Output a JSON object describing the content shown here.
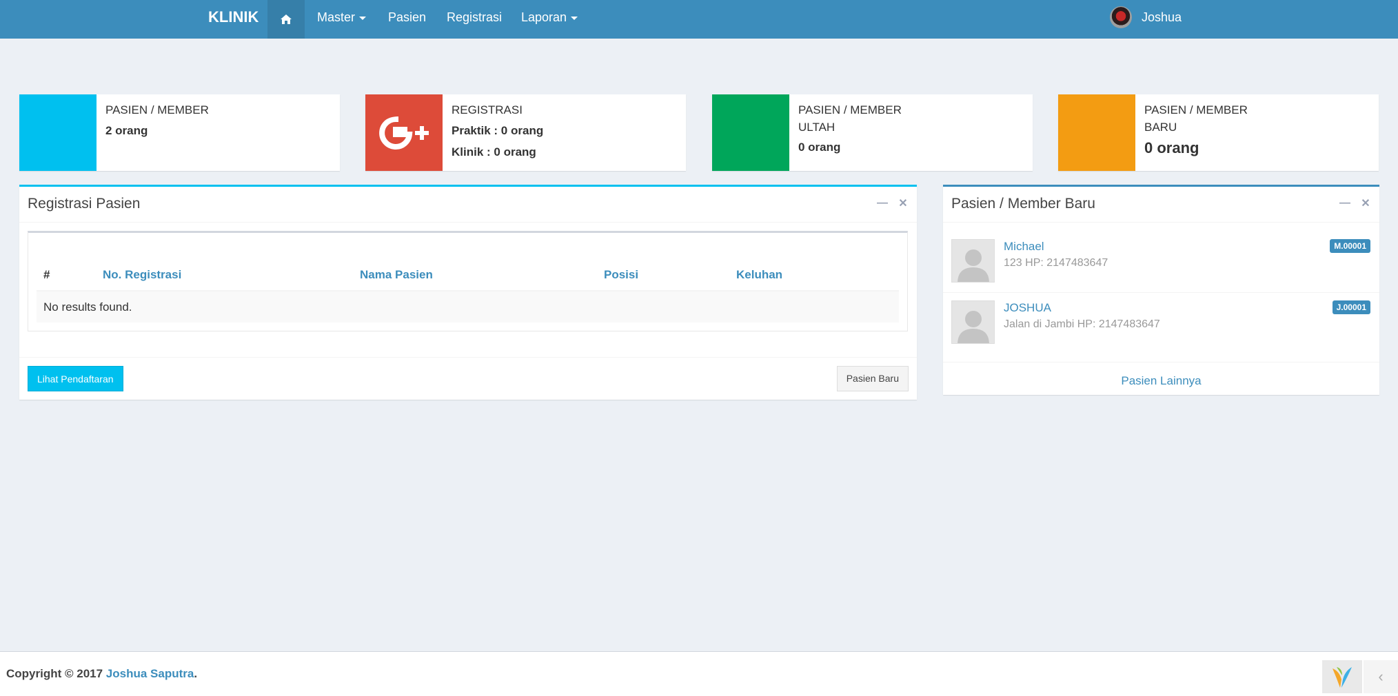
{
  "navbar": {
    "brand": "KLINIK",
    "home_icon": "home-icon",
    "items": [
      {
        "label": "Master",
        "dropdown": true
      },
      {
        "label": "Pasien",
        "dropdown": false
      },
      {
        "label": "Registrasi",
        "dropdown": false
      },
      {
        "label": "Laporan",
        "dropdown": true
      }
    ],
    "user": {
      "name": "Joshua"
    }
  },
  "info_boxes": [
    {
      "label": "PASIEN / MEMBER",
      "line1": "2 orang",
      "color": "#00c0ef",
      "icon": "user-icon"
    },
    {
      "label": "REGISTRASI",
      "line1": "Praktik : 0 orang",
      "line2": "Klinik : 0 orang",
      "color": "#dd4b39",
      "icon": "google-plus-icon"
    },
    {
      "label": "PASIEN / MEMBER",
      "label2": "ULTAH",
      "line1": "0 orang",
      "color": "#00a65a",
      "icon": "birthday-icon"
    },
    {
      "label": "PASIEN / MEMBER",
      "label2": "BARU",
      "line1": "0 orang",
      "color": "#f39c12",
      "icon": "user-plus-icon"
    }
  ],
  "registrasi_box": {
    "title": "Registrasi Pasien",
    "columns": [
      "#",
      "No. Registrasi",
      "Nama Pasien",
      "Posisi",
      "Keluhan"
    ],
    "empty_text": "No results found.",
    "btn_lihat": "Lihat Pendaftaran",
    "btn_baru": "Pasien Baru"
  },
  "member_box": {
    "title": "Pasien / Member Baru",
    "members": [
      {
        "name": "Michael",
        "desc": "123 HP: 2147483647",
        "code": "M.00001"
      },
      {
        "name": "JOSHUA",
        "desc": "Jalan di Jambi HP: 2147483647",
        "code": "J.00001"
      }
    ],
    "more_label": "Pasien Lainnya"
  },
  "footer": {
    "copyright_prefix": "Copyright © 2017 ",
    "author": "Joshua Saputra",
    "suffix": "."
  },
  "colors": {
    "primary": "#3c8dbc",
    "info": "#00c0ef",
    "danger": "#dd4b39",
    "success": "#00a65a",
    "warning": "#f39c12"
  }
}
